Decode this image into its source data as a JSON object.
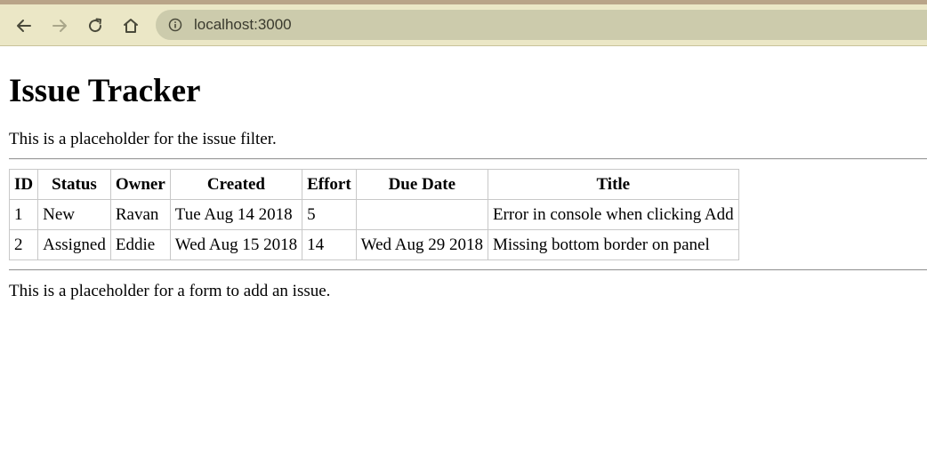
{
  "browser": {
    "url": "localhost:3000",
    "icons": {
      "back": "arrow-left-icon",
      "forward": "arrow-right-icon",
      "reload": "reload-icon",
      "home": "home-icon",
      "info": "info-icon"
    }
  },
  "page": {
    "title": "Issue Tracker",
    "filter_placeholder": "This is a placeholder for the issue filter.",
    "form_placeholder": "This is a placeholder for a form to add an issue.",
    "table": {
      "headers": [
        "ID",
        "Status",
        "Owner",
        "Created",
        "Effort",
        "Due Date",
        "Title"
      ],
      "rows": [
        [
          "1",
          "New",
          "Ravan",
          "Tue Aug 14 2018",
          "5",
          "",
          "Error in console when clicking Add"
        ],
        [
          "2",
          "Assigned",
          "Eddie",
          "Wed Aug 15 2018",
          "14",
          "Wed Aug 29 2018",
          "Missing bottom border on panel"
        ]
      ]
    }
  }
}
